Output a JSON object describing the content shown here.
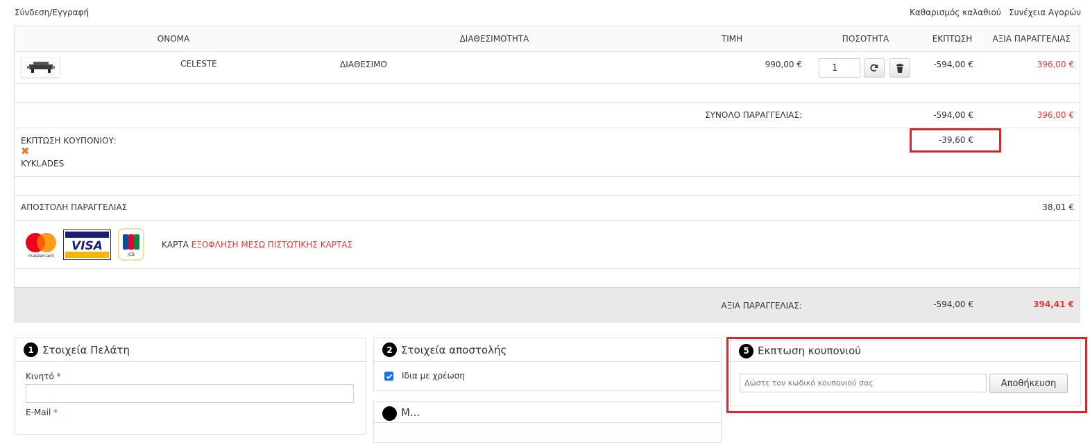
{
  "top_links": {
    "login": "Σύνδεση/Εγγραφή",
    "clear_cart": "Καθαρισμός καλαθιού",
    "continue_shopping": "Συνέχεια Αγορών"
  },
  "table": {
    "headers": {
      "name": "ΟΝΟΜΑ",
      "availability": "ΔΙΑΘΕΣΙΜΟΤΗΤΑ",
      "price": "ΤΙΜΗ",
      "quantity": "ΠΟΣΟΤΗΤΑ",
      "discount": "ΕΚΠΤΩΣΗ",
      "order_value": "ΑΞΙΑ ΠΑΡΑΓΓΕΛΙΑΣ"
    },
    "item": {
      "name": "CELESTE",
      "availability": "ΔΙΑΘΕΣΙΜΟ",
      "price": "990,00 €",
      "quantity": "1",
      "discount": "-594,00 €",
      "value": "396,00 €"
    },
    "subtotal": {
      "label": "ΣΥΝΟΛΟ ΠΑΡΑΓΓΕΛΙΑΣ:",
      "discount": "-594,00 €",
      "value": "396,00 €"
    },
    "coupon": {
      "label": "ΕΚΠΤΩΣΗ ΚΟΥΠΟΝΙΟΥ:",
      "code": "KYKLADES",
      "amount": "-39,60 €"
    },
    "shipping": {
      "label": "ΑΠΟΣΤΟΛΗ ΠΑΡΑΓΓΕΛΙΑΣ",
      "value": "38,01 €"
    },
    "payment": {
      "prefix": "ΚΑΡΤΑ",
      "method": "ΕΞΟΦΛΗΣΗ ΜΕΣΩ ΠΙΣΤΩΤΙΚΗΣ ΚΑΡΤΑΣ",
      "mastercard_text": "mastercard",
      "visa_text": "VISA",
      "jcb_text": "JCB"
    },
    "total": {
      "label": "ΑΞΙΑ ΠΑΡΑΓΓΕΛΙΑΣ:",
      "discount": "-594,00 €",
      "value": "394,41 €"
    }
  },
  "panels": {
    "customer": {
      "step": "1",
      "title": "Στοιχεία Πελάτη",
      "mobile_label": "Κινητό",
      "email_label": "E-Mail",
      "required_mark": "*"
    },
    "shipping": {
      "step": "2",
      "title": "Στοιχεία αποστολής",
      "same_as_billing": "Ιδια με χρέωση",
      "same_as_billing_checked": true,
      "next_title": "Μ..."
    },
    "coupon": {
      "step": "5",
      "title": "Εκπτωση κουπονιού",
      "placeholder": "Δώστε τον κωδικό κουπονιού σας",
      "save_label": "Αποθήκευση"
    }
  },
  "colors": {
    "accent_red": "#e0383a",
    "highlight": "#d9252b",
    "total_bg": "#e9e9e9",
    "checkbox_blue": "#1a73e8"
  }
}
